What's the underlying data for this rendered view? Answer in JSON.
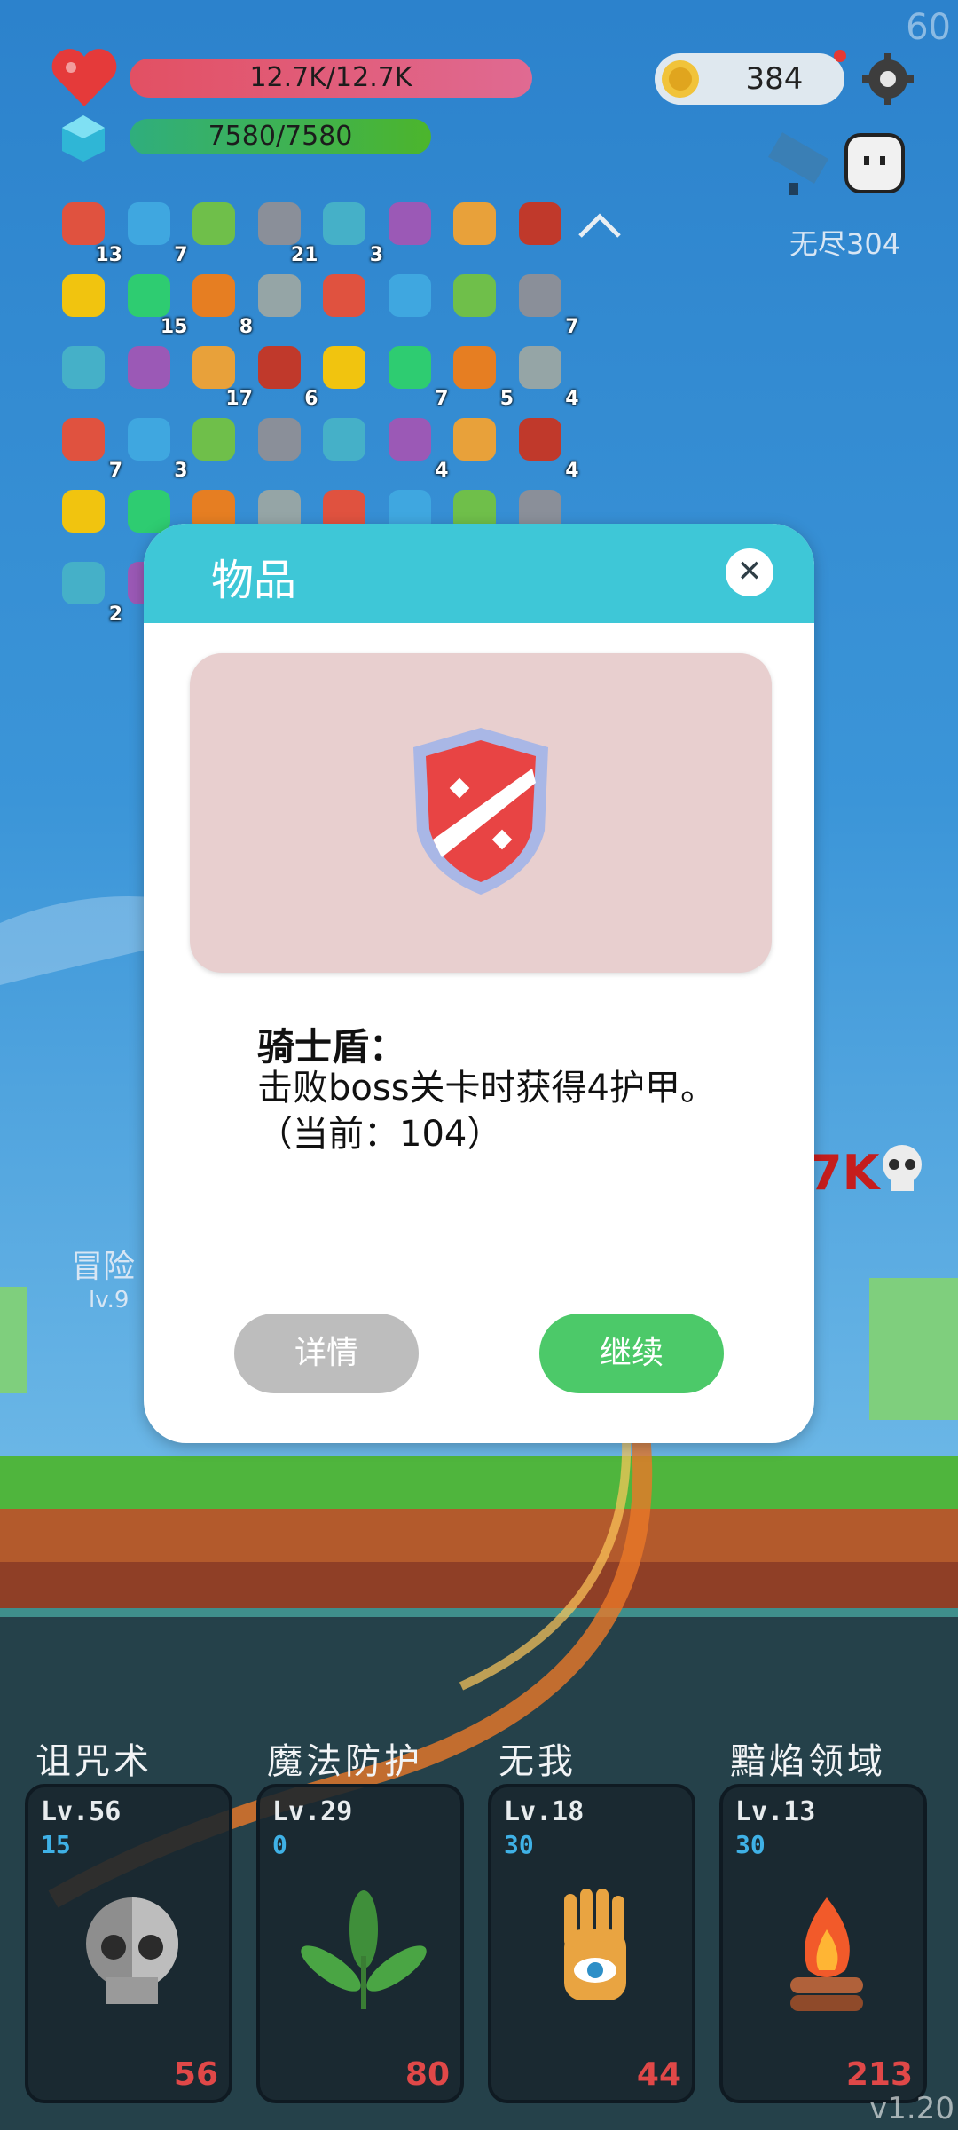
{
  "fps": "60",
  "version": "v1.20",
  "stats": {
    "hp_text": "12.7K/12.7K",
    "mp_text": "7580/7580",
    "coins": "384",
    "endless_label": "无尽304"
  },
  "inventory": [
    {
      "icon": "watermelon-icon",
      "count": "13"
    },
    {
      "icon": "speech-bubble-icon",
      "count": "7"
    },
    {
      "icon": "green-card-icon",
      "count": ""
    },
    {
      "icon": "sword-icon",
      "count": "21"
    },
    {
      "icon": "syringe-icon",
      "count": "3"
    },
    {
      "icon": "spiral-icon",
      "count": ""
    },
    {
      "icon": "blue-square-icon",
      "count": ""
    },
    {
      "icon": "wizard-hat-icon",
      "count": ""
    },
    {
      "icon": "icecream-icon",
      "count": ""
    },
    {
      "icon": "book-icon",
      "count": "15"
    },
    {
      "icon": "round-shield-icon",
      "count": "8"
    },
    {
      "icon": "scroll-icon",
      "count": ""
    },
    {
      "icon": "knight-shield-icon",
      "count": ""
    },
    {
      "icon": "unicorn-icon",
      "count": ""
    },
    {
      "icon": "mushroom-icon",
      "count": ""
    },
    {
      "icon": "dagger-icon",
      "count": "7"
    },
    {
      "icon": "magnet-icon",
      "count": ""
    },
    {
      "icon": "molecule-icon",
      "count": ""
    },
    {
      "icon": "apple-icon",
      "count": "17"
    },
    {
      "icon": "potion-icon",
      "count": "6"
    },
    {
      "icon": "heat-icon",
      "count": ""
    },
    {
      "icon": "flower-icon",
      "count": "7"
    },
    {
      "icon": "red-pill-icon",
      "count": "5"
    },
    {
      "icon": "blue-pill-icon",
      "count": "4"
    },
    {
      "icon": "green-flask-icon",
      "count": "7"
    },
    {
      "icon": "bow-icon",
      "count": "3"
    },
    {
      "icon": "id-card-icon",
      "count": ""
    },
    {
      "icon": "jam-jar-icon",
      "count": ""
    },
    {
      "icon": "playing-cards-icon",
      "count": ""
    },
    {
      "icon": "tombstone-icon",
      "count": "4"
    },
    {
      "icon": "shirt-icon",
      "count": ""
    },
    {
      "icon": "sunflower-icon",
      "count": "4"
    },
    {
      "icon": "briefcase-icon",
      "count": ""
    },
    {
      "icon": "beer-icon",
      "count": ""
    },
    {
      "icon": "flag-icon",
      "count": ""
    },
    {
      "icon": "meteor-icon",
      "count": ""
    },
    {
      "icon": "brain-icon",
      "count": ""
    },
    {
      "icon": "tulip-icon",
      "count": ""
    },
    {
      "icon": "compass-icon",
      "count": ""
    },
    {
      "icon": "red-block-icon",
      "count": ""
    },
    {
      "icon": "pineapple-icon",
      "count": "2"
    },
    {
      "icon": "yellow-fruit-icon",
      "count": ""
    },
    {
      "icon": "lamp-frame-icon",
      "count": ""
    },
    {
      "icon": "galaxy-frame-icon",
      "count": ""
    }
  ],
  "adventure": {
    "label": "冒险",
    "level": "lv.9",
    "score_suffix": "7K"
  },
  "skills": [
    {
      "name": "诅咒术",
      "level": "Lv.56",
      "cost": "15",
      "value": "56",
      "icon": "skull-icon"
    },
    {
      "name": "魔法防护",
      "level": "Lv.29",
      "cost": "0",
      "value": "80",
      "icon": "leaf-icon"
    },
    {
      "name": "无我",
      "level": "Lv.18",
      "cost": "30",
      "value": "44",
      "icon": "eye-hand-icon"
    },
    {
      "name": "黯焰领域",
      "level": "Lv.13",
      "cost": "30",
      "value": "213",
      "icon": "campfire-icon"
    }
  ],
  "modal": {
    "title": "物品",
    "close": "✕",
    "item_name": "骑士盾：",
    "item_desc": "击败boss关卡时获得4护甲。（当前：104）",
    "detail_button": "详情",
    "continue_button": "继续"
  },
  "colors": {
    "sky": "#2f86cf",
    "modal_header": "#3ec7d7",
    "continue_green": "#4cc969",
    "detail_gray": "#bdbdbd",
    "skill_cost_blue": "#3fb1e6",
    "skill_value_red": "#e04848"
  }
}
